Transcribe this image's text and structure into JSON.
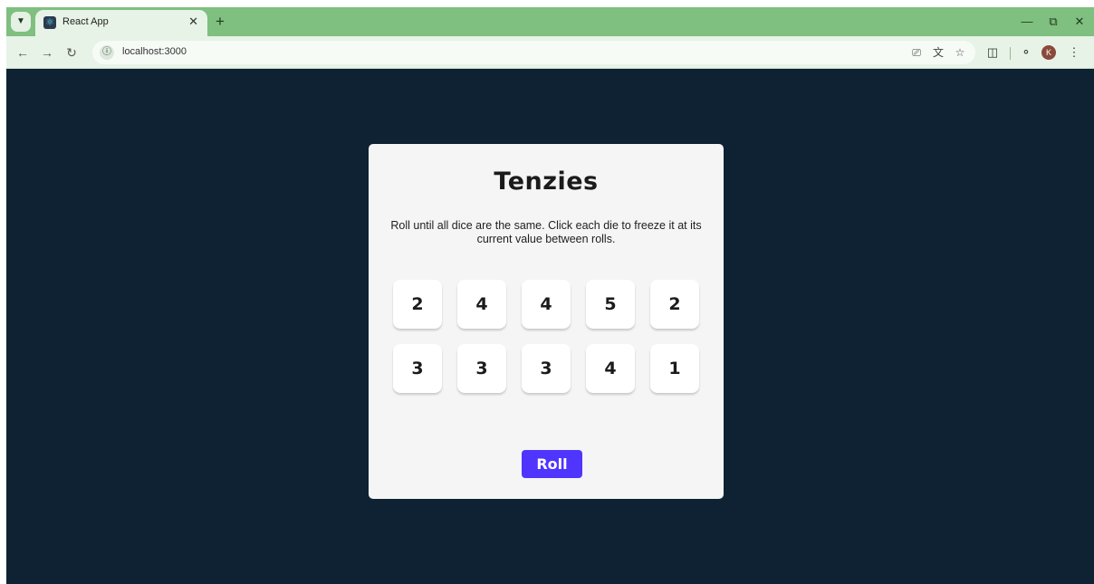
{
  "browser": {
    "tab_title": "React App",
    "url": "localhost:3000",
    "avatar_initial": "K",
    "accent_color": "#7fbf7f"
  },
  "game": {
    "title": "Tenzies",
    "instructions": "Roll until all dice are the same. Click each die to freeze it at its current value between rolls.",
    "dice": [
      "2",
      "4",
      "4",
      "5",
      "2",
      "3",
      "3",
      "3",
      "4",
      "1"
    ],
    "roll_label": "Roll",
    "roll_color": "#5035ff",
    "background_color": "#0e2233"
  }
}
